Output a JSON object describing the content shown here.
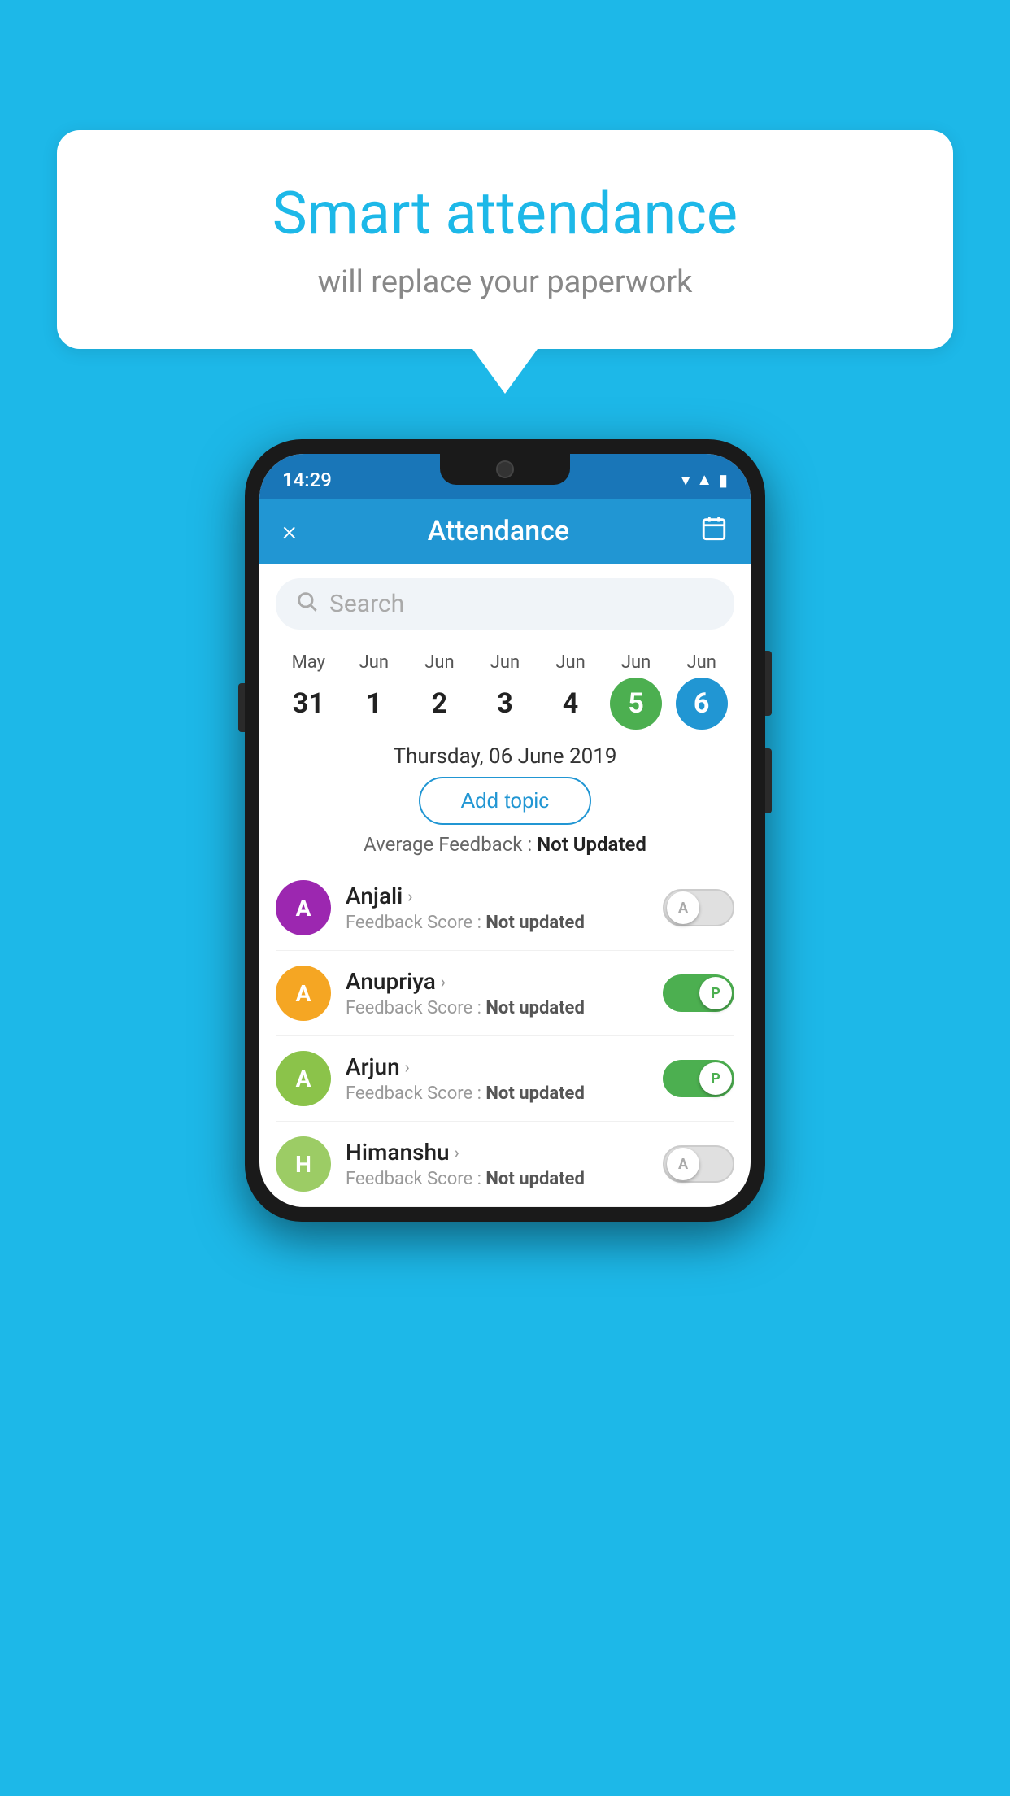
{
  "background": {
    "color": "#1db8e8"
  },
  "speech_bubble": {
    "title": "Smart attendance",
    "subtitle": "will replace your paperwork"
  },
  "app": {
    "status_bar": {
      "time": "14:29"
    },
    "app_bar": {
      "close_label": "×",
      "title": "Attendance"
    },
    "search": {
      "placeholder": "Search"
    },
    "calendar": {
      "days": [
        {
          "month": "May",
          "date": "31",
          "state": "normal"
        },
        {
          "month": "Jun",
          "date": "1",
          "state": "normal"
        },
        {
          "month": "Jun",
          "date": "2",
          "state": "normal"
        },
        {
          "month": "Jun",
          "date": "3",
          "state": "normal"
        },
        {
          "month": "Jun",
          "date": "4",
          "state": "normal"
        },
        {
          "month": "Jun",
          "date": "5",
          "state": "today"
        },
        {
          "month": "Jun",
          "date": "6",
          "state": "selected"
        }
      ],
      "selected_date_label": "Thursday, 06 June 2019"
    },
    "add_topic_label": "Add topic",
    "avg_feedback_label": "Average Feedback :",
    "avg_feedback_value": "Not Updated",
    "students": [
      {
        "name": "Anjali",
        "avatar_letter": "A",
        "avatar_color": "#9c27b0",
        "feedback_label": "Feedback Score :",
        "feedback_value": "Not updated",
        "toggle": "off",
        "toggle_letter": "A"
      },
      {
        "name": "Anupriya",
        "avatar_letter": "A",
        "avatar_color": "#f5a623",
        "feedback_label": "Feedback Score :",
        "feedback_value": "Not updated",
        "toggle": "on",
        "toggle_letter": "P"
      },
      {
        "name": "Arjun",
        "avatar_letter": "A",
        "avatar_color": "#8bc34a",
        "feedback_label": "Feedback Score :",
        "feedback_value": "Not updated",
        "toggle": "on",
        "toggle_letter": "P"
      },
      {
        "name": "Himanshu",
        "avatar_letter": "H",
        "avatar_color": "#9ccc65",
        "feedback_label": "Feedback Score :",
        "feedback_value": "Not updated",
        "toggle": "off",
        "toggle_letter": "A"
      }
    ]
  }
}
